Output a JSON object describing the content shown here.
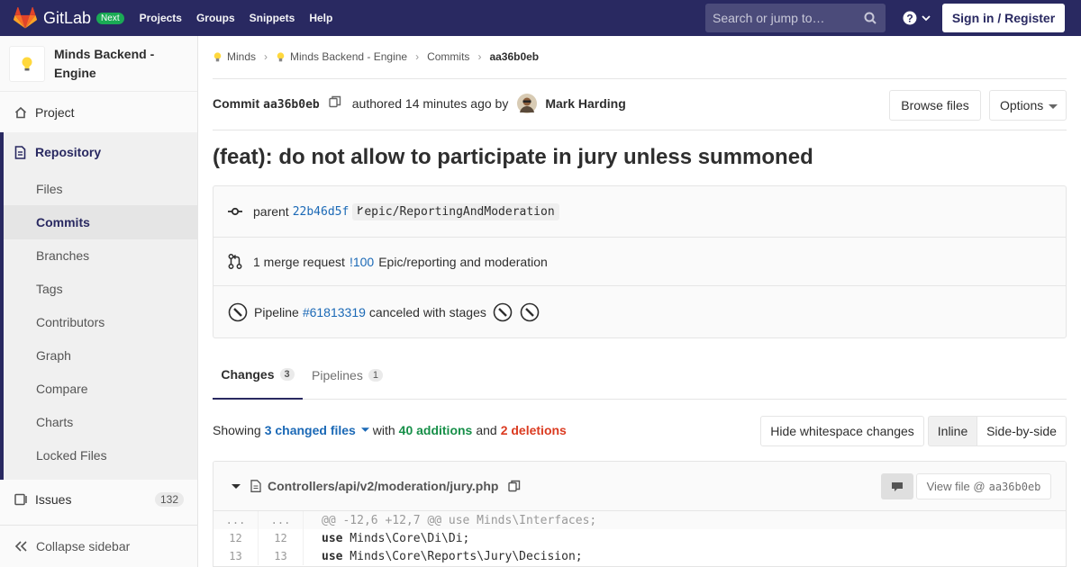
{
  "nav": {
    "brand": "GitLab",
    "badge": "Next",
    "links": [
      "Projects",
      "Groups",
      "Snippets",
      "Help"
    ],
    "search_placeholder": "Search or jump to…",
    "sign_in": "Sign in / Register"
  },
  "sidebar": {
    "project_name": "Minds Backend - Engine",
    "project": "Project",
    "repository": "Repository",
    "repo_items": [
      "Files",
      "Commits",
      "Branches",
      "Tags",
      "Contributors",
      "Graph",
      "Compare",
      "Charts",
      "Locked Files"
    ],
    "issues": "Issues",
    "issues_count": "132",
    "collapse": "Collapse sidebar"
  },
  "breadcrumb": [
    "Minds",
    "Minds Backend - Engine",
    "Commits",
    "aa36b0eb"
  ],
  "commit": {
    "label": "Commit",
    "sha": "aa36b0eb",
    "authored": "authored 14 minutes ago by",
    "author": "Mark Harding",
    "browse_files": "Browse files",
    "options": "Options",
    "title": "(feat): do not allow to participate in jury unless summoned"
  },
  "info": {
    "parent_label": "parent",
    "parent_sha": "22b46d5f",
    "branch": "epic/ReportingAndModeration",
    "mr_prefix": "1 merge request",
    "mr_id": "!100",
    "mr_title": "Epic/reporting and moderation",
    "pipeline_label": "Pipeline",
    "pipeline_id": "#61813319",
    "pipeline_status": "canceled with stages"
  },
  "tabs": [
    {
      "label": "Changes",
      "count": "3"
    },
    {
      "label": "Pipelines",
      "count": "1"
    }
  ],
  "stats": {
    "showing": "Showing",
    "changed_files": "3 changed files",
    "with": "with",
    "additions": "40 additions",
    "and": "and",
    "deletions": "2 deletions",
    "hide_ws": "Hide whitespace changes",
    "inline": "Inline",
    "side_by_side": "Side-by-side"
  },
  "file": {
    "path": "Controllers/api/v2/moderation/jury.php",
    "view_file": "View file @",
    "view_sha": "aa36b0eb"
  },
  "diff": [
    {
      "old": "...",
      "new": "...",
      "kw": "",
      "text": "@@ -12,6 +12,7 @@ use Minds\\Interfaces;"
    },
    {
      "old": "12",
      "new": "12",
      "kw": "use",
      "text": " Minds\\Core\\Di\\Di;"
    },
    {
      "old": "13",
      "new": "13",
      "kw": "use",
      "text": " Minds\\Core\\Reports\\Jury\\Decision;"
    }
  ],
  "colors": {
    "navbar": "#292961",
    "link": "#1b69b6",
    "additions": "#168f48",
    "deletions": "#db3b21",
    "badge_next": "#1aaa55"
  }
}
